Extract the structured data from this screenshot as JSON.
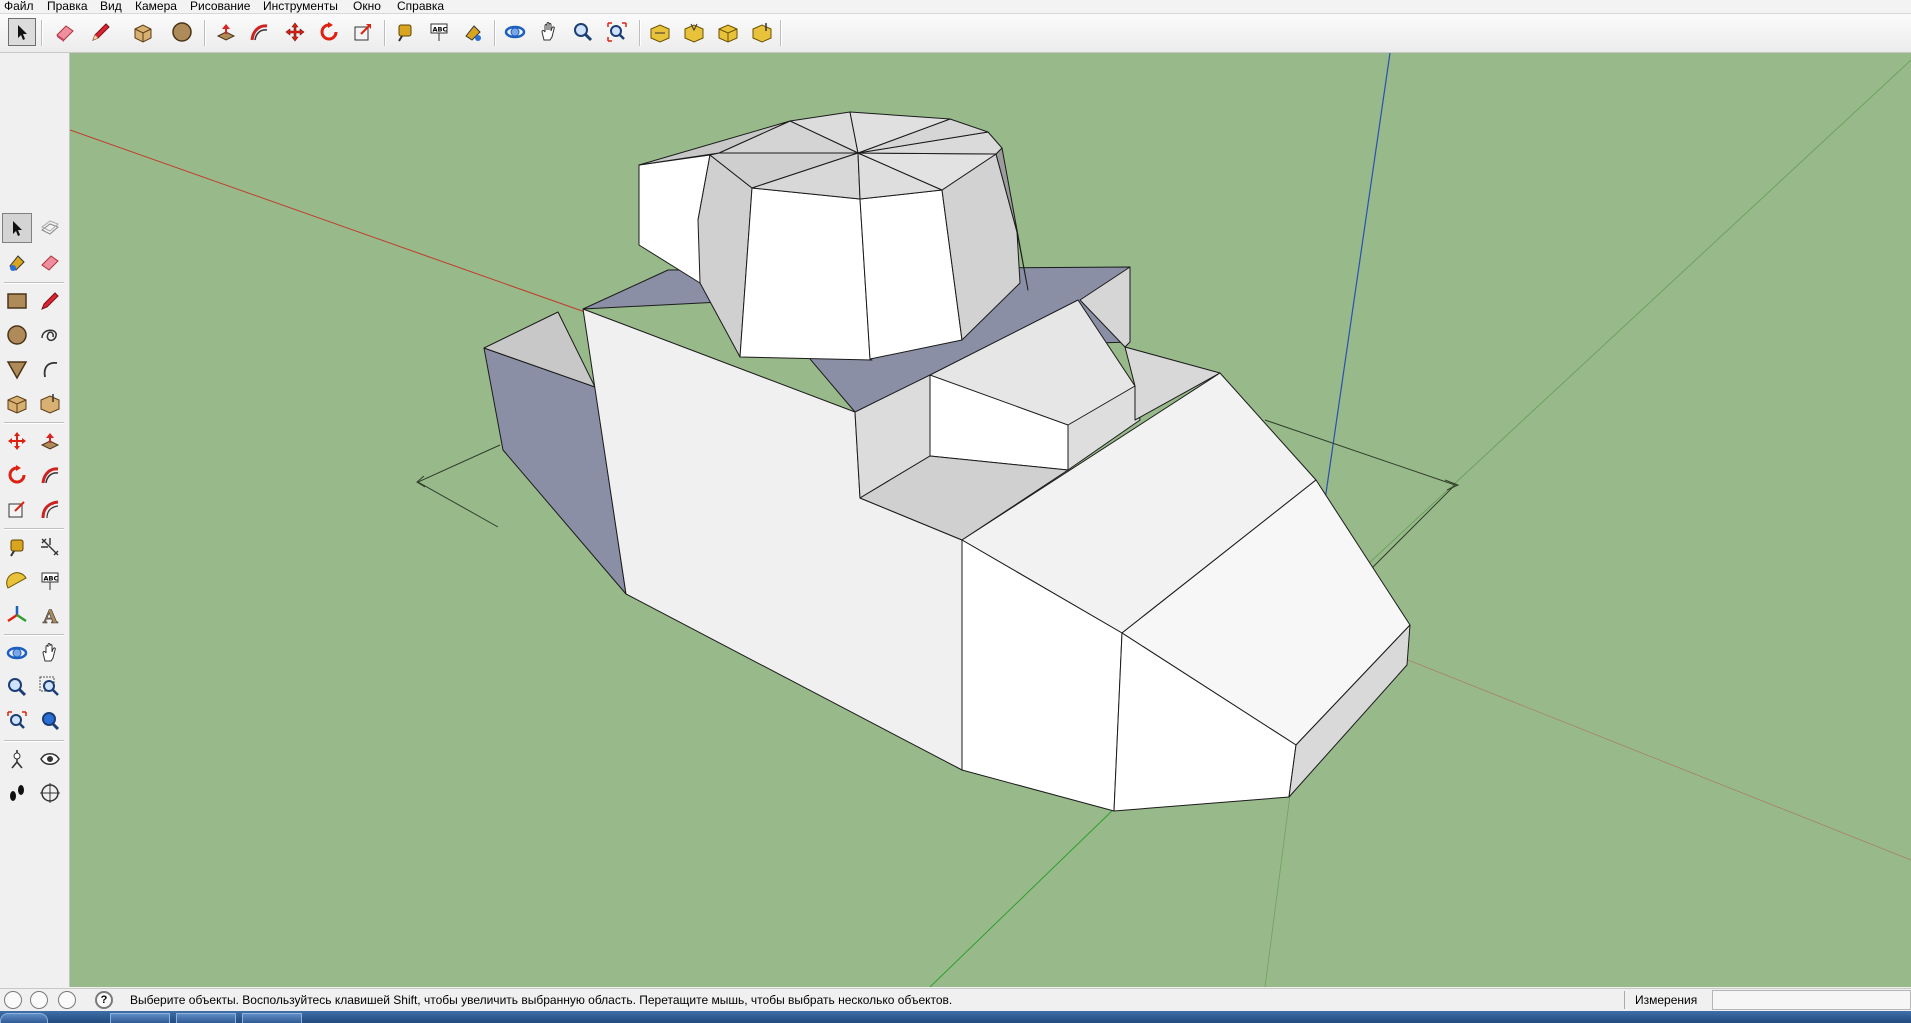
{
  "menu": [
    "Файл",
    "Правка",
    "Вид",
    "Камера",
    "Рисование",
    "Инструменты",
    "Окно",
    "Справка"
  ],
  "toolbar": {
    "tools": [
      "select-icon",
      "eraser-icon",
      "pencil-icon",
      "paint-bucket-icon",
      "circle-icon",
      "push-pull-icon",
      "follow-me-icon",
      "move-icon",
      "rotate-icon",
      "scale-icon",
      "tape-measure-icon",
      "text-icon",
      "paint-icon",
      "orbit-icon",
      "pan-icon",
      "zoom-icon",
      "zoom-extents-icon",
      "scene-1-icon",
      "scene-2-icon",
      "scene-3-icon",
      "scene-4-icon"
    ]
  },
  "large_toolset": {
    "tools": [
      "select-icon",
      "make-component-icon",
      "paint-bucket-icon",
      "eraser-icon",
      "rectangle-icon",
      "line-icon",
      "circle-icon",
      "freehand-icon",
      "polygon-icon",
      "arc-icon",
      "section-icon",
      "section-2-icon",
      "move-icon",
      "push-pull-icon",
      "rotate-icon",
      "follow-me-icon",
      "scale-icon",
      "offset-icon",
      "tape-measure-icon",
      "dimension-icon",
      "protractor-icon",
      "text-icon",
      "axes-icon",
      "3d-text-icon",
      "orbit-icon",
      "pan-icon",
      "zoom-icon",
      "zoom-window-icon",
      "zoom-extents-icon",
      "previous-view-icon",
      "position-camera-icon",
      "look-around-icon",
      "walk-icon",
      "section-plane-icon"
    ]
  },
  "status": {
    "message": "Выберите объекты. Воспользуйтесь клавишей Shift, чтобы увеличить выбранную область. Перетащите мышь, чтобы выбрать несколько объектов.",
    "measurements_label": "Измерения",
    "measurements_value": "",
    "help_glyph": "?"
  },
  "colors": {
    "viewport_background": "#98ba8a",
    "face_front": "#ffffff",
    "face_back": "#8a8fa5",
    "axis_red": "#c0392b",
    "axis_green": "#2e9e2e",
    "axis_blue": "#2a4fb0"
  }
}
